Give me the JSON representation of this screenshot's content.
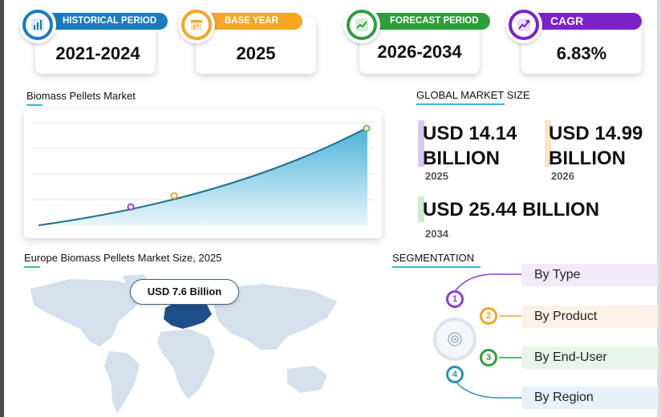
{
  "cards": [
    {
      "label": "HISTORICAL PERIOD",
      "value": "2021-2024",
      "color": "#1b7bbf",
      "icon": "bar-chart-icon"
    },
    {
      "label": "BASE YEAR",
      "value": "2025",
      "color": "#f5a623",
      "icon": "calendar-icon"
    },
    {
      "label": "FORECAST PERIOD",
      "value": "2026-2034",
      "color": "#2e9e3a",
      "icon": "forecast-chart-icon"
    },
    {
      "label": "CAGR",
      "value": "6.83%",
      "color": "#7b22c9",
      "icon": "growth-chart-icon"
    }
  ],
  "market_chart": {
    "title": "Biomass Pellets Market",
    "accent_color": "#3bb6d6",
    "marker_colors": [
      "#9a3fd6",
      "#f5a623",
      "#6cc04a"
    ]
  },
  "global": {
    "title": "GLOBAL MARKET SIZE",
    "stats": [
      {
        "value_line1": "USD 14.14",
        "value_line2": "BILLION",
        "year": "2025",
        "color": "#c9b6e8"
      },
      {
        "value_line1": "USD 14.99",
        "value_line2": "BILLION",
        "year": "2026",
        "color": "#f8dcb7"
      },
      {
        "value_line1": "USD 25.44 BILLION",
        "year": "2034",
        "color": "#bfe3c4"
      }
    ]
  },
  "europe": {
    "title": "Europe Biomass Pellets Market Size, 2025",
    "label": "USD 7.6 Billion",
    "highlight_color": "#1e4f8a",
    "map_color": "#cfdce8"
  },
  "segmentation": {
    "title": "SEGMENTATION",
    "items": [
      {
        "number": "1",
        "label": "By Type",
        "color": "#8e3fd1",
        "bg": "#f1eaf9"
      },
      {
        "number": "2",
        "label": "By Product",
        "color": "#f5a623",
        "bg": "#fdf2e6"
      },
      {
        "number": "3",
        "label": "By End-User",
        "color": "#2e9e3a",
        "bg": "#e9f5ea"
      },
      {
        "number": "4",
        "label": "By Region",
        "color": "#2c8fb8",
        "bg": "#e6f2f7"
      }
    ]
  }
}
